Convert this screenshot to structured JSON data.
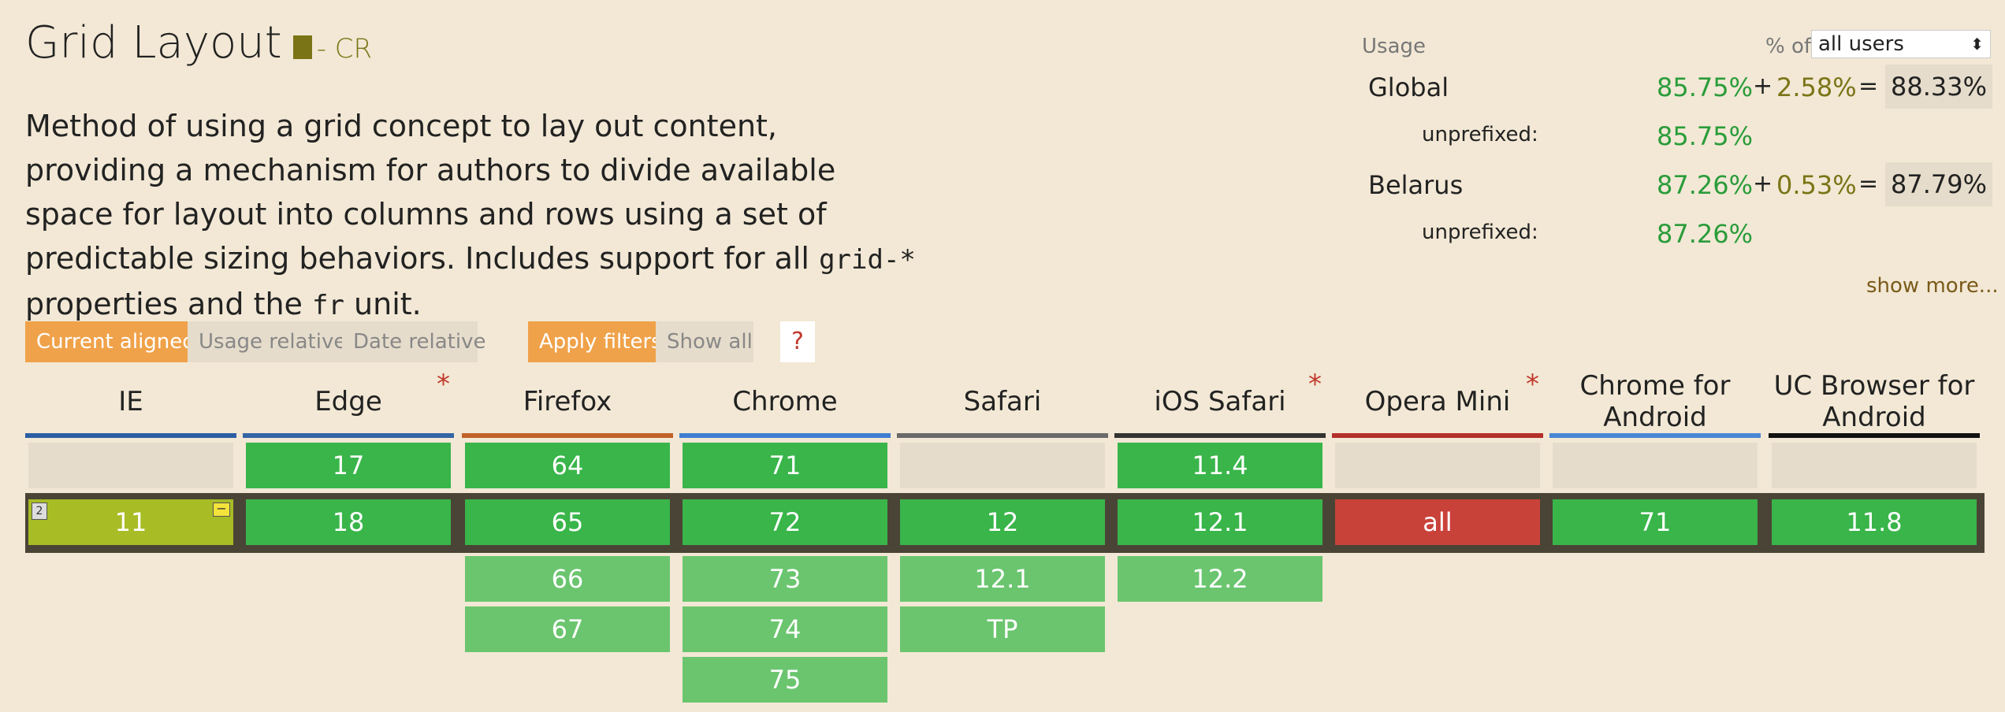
{
  "feature": {
    "title": "Grid Layout",
    "status": "- CR",
    "desc_parts": [
      "Method of using a grid concept to lay out content, providing a mechanism for authors to divide available space for layout into columns and rows using a set of predictable sizing behaviors. Includes support for all ",
      "grid-*",
      " properties and the ",
      "fr",
      " unit."
    ]
  },
  "usage": {
    "label": "Usage",
    "pct_of": "% of",
    "users_select": "all users",
    "rows": [
      {
        "region": "Global",
        "v1": "85.75%",
        "plus": "+",
        "v2": "2.58%",
        "eq": "=",
        "total": "88.33%"
      },
      {
        "sub": "unprefixed:",
        "v1": "85.75%"
      },
      {
        "region": "Belarus",
        "v1": "87.26%",
        "plus": "+",
        "v2": "0.53%",
        "eq": "=",
        "total": "87.79%"
      },
      {
        "sub": "unprefixed:",
        "v1": "87.26%"
      }
    ],
    "show_more": "show more..."
  },
  "filters": {
    "current_aligned": "Current aligned",
    "usage_relative": "Usage relative",
    "date_relative": "Date relative",
    "apply_filters": "Apply filters",
    "show_all": "Show all",
    "help": "?"
  },
  "browsers": [
    {
      "name": "IE",
      "color": "#2b5ea3",
      "star": false
    },
    {
      "name": "Edge",
      "color": "#3465a4",
      "star": true
    },
    {
      "name": "Firefox",
      "color": "#c1622a",
      "star": false
    },
    {
      "name": "Chrome",
      "color": "#3f7ed1",
      "star": false
    },
    {
      "name": "Safari",
      "color": "#6a6a6a",
      "star": false
    },
    {
      "name": "iOS Safari",
      "color": "#333333",
      "star": true
    },
    {
      "name": "Opera Mini",
      "color": "#b3302b",
      "star": true
    },
    {
      "name": "Chrome for Android",
      "color": "#4a86d4",
      "star": false
    },
    {
      "name": "UC Browser for Android",
      "color": "#111111",
      "star": false
    }
  ],
  "star_symbol": "*",
  "versions": {
    "ie": {
      "prev": [],
      "current": "11",
      "next": []
    },
    "edge": {
      "prev": [
        "17"
      ],
      "current": "18",
      "next": []
    },
    "firefox": {
      "prev": [
        "64"
      ],
      "current": "65",
      "next": [
        "66",
        "67"
      ]
    },
    "chrome": {
      "prev": [
        "71"
      ],
      "current": "72",
      "next": [
        "73",
        "74",
        "75"
      ]
    },
    "safari": {
      "prev": [],
      "current": "12",
      "next": [
        "12.1",
        "TP"
      ]
    },
    "ios": {
      "prev": [
        "11.4"
      ],
      "current": "12.1",
      "next": [
        "12.2"
      ]
    },
    "opmini": {
      "prev": [],
      "current": "all",
      "next": []
    },
    "chand": {
      "prev": [],
      "current": "71",
      "next": []
    },
    "ucand": {
      "prev": [],
      "current": "11.8",
      "next": []
    }
  },
  "ie_note_badge": "2",
  "ie_flag": "−"
}
